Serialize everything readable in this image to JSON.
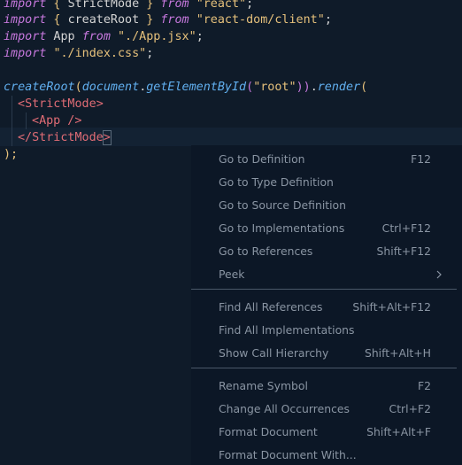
{
  "code": {
    "l1": {
      "t1": "import",
      "t2": " { ",
      "t3": "StrictMode",
      "t4": " } ",
      "t5": "from",
      "t6": " ",
      "t7": "\"react\"",
      "t8": ";"
    },
    "l2": {
      "t1": "import",
      "t2": " { ",
      "t3": "createRoot",
      "t4": " } ",
      "t5": "from",
      "t6": " ",
      "t7": "\"react-dom/client\"",
      "t8": ";"
    },
    "l3": {
      "t1": "import",
      "t2": " App ",
      "t3": "from",
      "t4": " ",
      "t5": "\"./App.jsx\"",
      "t6": ";"
    },
    "l4": {
      "t1": "import",
      "t2": " ",
      "t3": "\"./index.css\"",
      "t4": ";"
    },
    "l6": {
      "t1": "createRoot",
      "t2": "(",
      "t3": "document",
      "t4": ".",
      "t5": "getElementById",
      "t6": "(",
      "t7": "\"root\"",
      "t8": "))",
      "t9": ".",
      "t10": "render",
      "t11": "("
    },
    "l7": {
      "t1": "<",
      "t2": "StrictMode",
      "t3": ">"
    },
    "l8": {
      "t1": "<",
      "t2": "App",
      "t3": " />"
    },
    "l9": {
      "t1": "</",
      "t2": "StrictMode",
      "t3": ">"
    },
    "l10": {
      "t1": ");"
    }
  },
  "context_menu": {
    "items": [
      {
        "label": "Go to Definition",
        "shortcut": "F12"
      },
      {
        "label": "Go to Type Definition",
        "shortcut": ""
      },
      {
        "label": "Go to Source Definition",
        "shortcut": ""
      },
      {
        "label": "Go to Implementations",
        "shortcut": "Ctrl+F12"
      },
      {
        "label": "Go to References",
        "shortcut": "Shift+F12"
      },
      {
        "label": "Peek",
        "shortcut": ""
      },
      {
        "label": "Find All References",
        "shortcut": "Shift+Alt+F12"
      },
      {
        "label": "Find All Implementations",
        "shortcut": ""
      },
      {
        "label": "Show Call Hierarchy",
        "shortcut": "Shift+Alt+H"
      },
      {
        "label": "Rename Symbol",
        "shortcut": "F2"
      },
      {
        "label": "Change All Occurrences",
        "shortcut": "Ctrl+F2"
      },
      {
        "label": "Format Document",
        "shortcut": "Shift+Alt+F"
      },
      {
        "label": "Format Document With...",
        "shortcut": ""
      }
    ],
    "submenu_icon": "chevron-right-icon"
  },
  "colors": {
    "background": "#0f1b29",
    "menu_background": "#0c1726",
    "keyword": "#c678dd",
    "string": "#e5c07b",
    "function": "#61afef",
    "tag": "#e06c75"
  }
}
